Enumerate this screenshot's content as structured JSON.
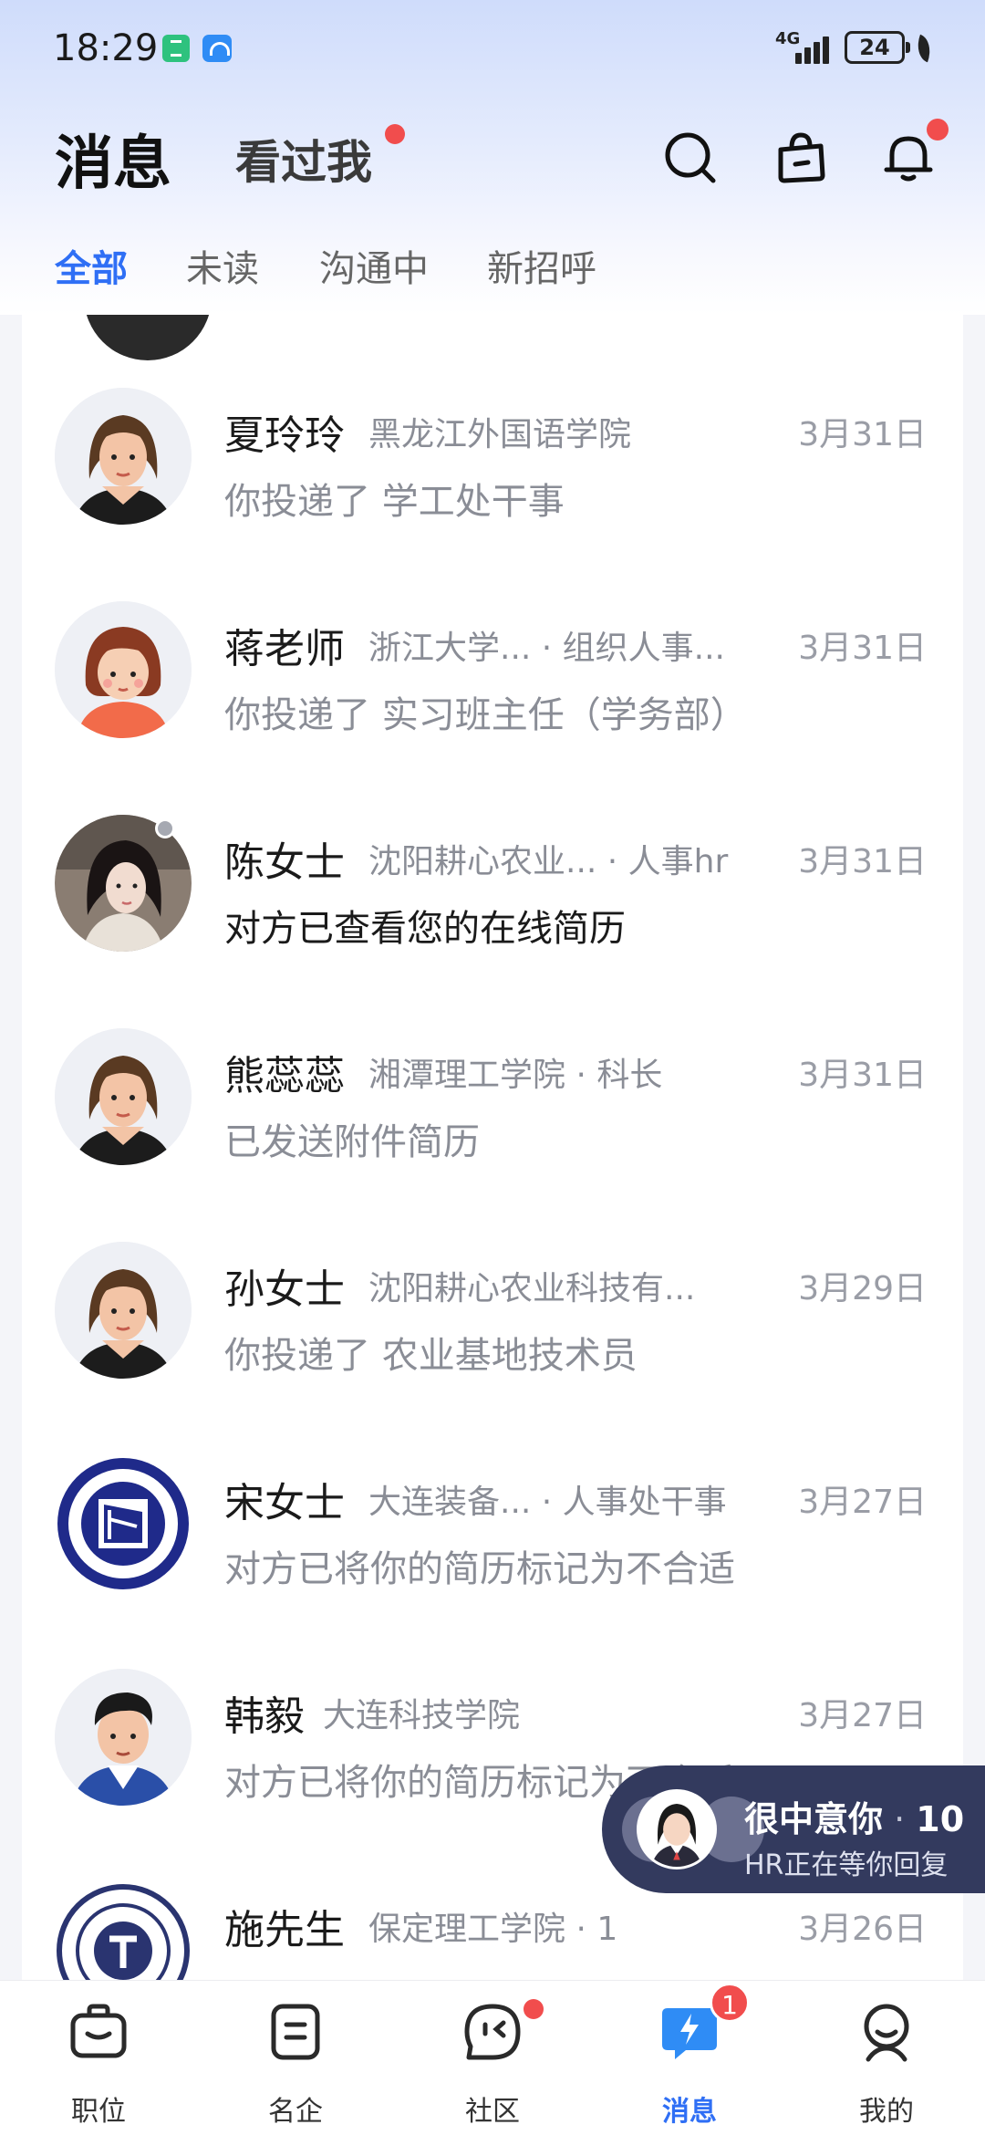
{
  "status_bar": {
    "time": "18:29",
    "network": "4G",
    "battery": "24"
  },
  "header": {
    "title": "消息",
    "seen_me": "看过我",
    "icons": [
      "search-icon",
      "briefcase-icon",
      "bell-icon"
    ]
  },
  "tabs": [
    {
      "label": "全部",
      "active": true
    },
    {
      "label": "未读",
      "active": false
    },
    {
      "label": "沟通中",
      "active": false
    },
    {
      "label": "新招呼",
      "active": false
    }
  ],
  "messages": [
    {
      "name": "夏玲玲",
      "org": "黑龙江外国语学院",
      "date": "3月31日",
      "text": "你投递了 学工处干事",
      "avatar": "female-cartoon-avatar"
    },
    {
      "name": "蒋老师",
      "org": "浙江大学... · 组织人事...",
      "date": "3月31日",
      "text": "你投递了 实习班主任（学务部）",
      "avatar": "female-short-hair-avatar"
    },
    {
      "name": "陈女士",
      "org": "沈阳耕心农业... · 人事hr",
      "date": "3月31日",
      "text": "对方已查看您的在线简历",
      "avatar": "photo-avatar",
      "online": true
    },
    {
      "name": "熊蕊蕊",
      "org": "湘潭理工学院 · 科长",
      "date": "3月31日",
      "text": "已发送附件简历",
      "avatar": "female-cartoon-avatar"
    },
    {
      "name": "孙女士",
      "org": "沈阳耕心农业科技有...",
      "date": "3月29日",
      "text": "你投递了 农业基地技术员",
      "avatar": "female-cartoon-avatar"
    },
    {
      "name": "宋女士",
      "org": "大连装备... · 人事处干事",
      "date": "3月27日",
      "text": "对方已将你的简历标记为不合适",
      "avatar": "school-logo-avatar"
    },
    {
      "name": "韩毅",
      "org": "大连科技学院",
      "date": "3月27日",
      "text": "对方已将你的简历标记为不合适",
      "avatar": "male-cartoon-avatar"
    },
    {
      "name": "施先生",
      "org": "保定理工学院 · 1",
      "date": "3月26日",
      "text": "",
      "avatar": "school-seal-avatar"
    }
  ],
  "float_banner": {
    "title": "很中意你",
    "count": "10",
    "subtitle": "HR正在等你回复"
  },
  "bottom_nav": [
    {
      "label": "职位",
      "icon": "briefcase-icon"
    },
    {
      "label": "名企",
      "icon": "building-icon"
    },
    {
      "label": "社区",
      "icon": "chat-face-icon",
      "dot": true
    },
    {
      "label": "消息",
      "icon": "message-bolt-icon",
      "badge": "1",
      "active": true
    },
    {
      "label": "我的",
      "icon": "profile-icon"
    }
  ],
  "colors": {
    "accent": "#2f6ff5",
    "badge": "#f14d4d",
    "banner": "#333a5e"
  }
}
